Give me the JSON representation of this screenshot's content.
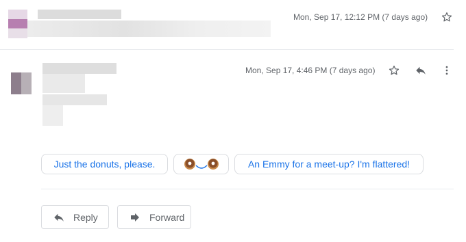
{
  "message1": {
    "date": "Mon, Sep 17, 12:12 PM (7 days ago)"
  },
  "message2": {
    "date": "Mon, Sep 17, 4:46 PM (7 days ago)"
  },
  "smart_replies": [
    {
      "label": "Just the donuts, please."
    },
    {
      "label": "🍩‿🍩"
    },
    {
      "label": "An Emmy for a meet-up? I'm flattered!"
    }
  ],
  "actions": {
    "reply_label": "Reply",
    "forward_label": "Forward"
  },
  "icons": {
    "star": "star-icon",
    "reply": "reply-icon",
    "more": "more-vert-icon",
    "forward": "forward-icon"
  },
  "colors": {
    "chip_text": "#1a73e8",
    "donut": "#c98a4b",
    "icon": "#5f6368"
  }
}
